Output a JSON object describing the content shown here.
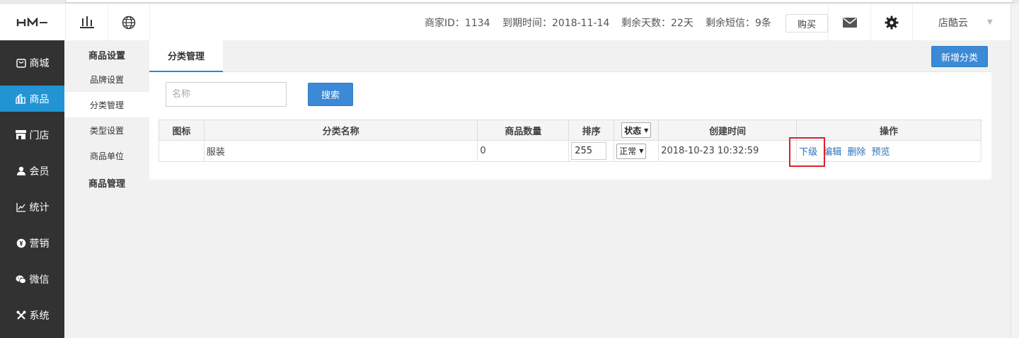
{
  "header": {
    "logo": "HM",
    "merchant_id": "商家ID：1134",
    "expiry": "到期时间：2018-11-14",
    "remaining_days": "剩余天数：22天",
    "remaining_sms": "剩余短信：9条",
    "buy_label": "购买",
    "store_name": "店酷云"
  },
  "sidebar": {
    "items": [
      {
        "label": "商城",
        "icon": "store-icon"
      },
      {
        "label": "商品",
        "icon": "goods-icon"
      },
      {
        "label": "门店",
        "icon": "shop-icon"
      },
      {
        "label": "会员",
        "icon": "member-icon"
      },
      {
        "label": "统计",
        "icon": "stats-icon"
      },
      {
        "label": "营销",
        "icon": "marketing-icon"
      },
      {
        "label": "微信",
        "icon": "wechat-icon"
      },
      {
        "label": "系统",
        "icon": "system-icon"
      }
    ],
    "active": "商品"
  },
  "submenu": {
    "section1": "商品设置",
    "items": [
      "品牌设置",
      "分类管理",
      "类型设置",
      "商品单位"
    ],
    "active": "分类管理",
    "section2": "商品管理"
  },
  "main": {
    "tab": "分类管理",
    "add_button": "新增分类",
    "search_placeholder": "名称",
    "search_button": "搜索",
    "table": {
      "headers": [
        "图标",
        "分类名称",
        "商品数量",
        "排序",
        "状态",
        "创建时间",
        "操作"
      ],
      "rows": [
        {
          "icon": "",
          "name": "服装",
          "count": "0",
          "sort": "255",
          "status": "正常",
          "created": "2018-10-23 10:32:59",
          "actions": [
            "下级",
            "编辑",
            "删除",
            "预览"
          ]
        }
      ]
    }
  },
  "colors": {
    "sidebar_bg": "#323232",
    "active_blue": "#2294d4",
    "button_blue": "#3c8ad6",
    "link_blue": "#2a6fb8",
    "highlight_red": "#d9232b"
  }
}
